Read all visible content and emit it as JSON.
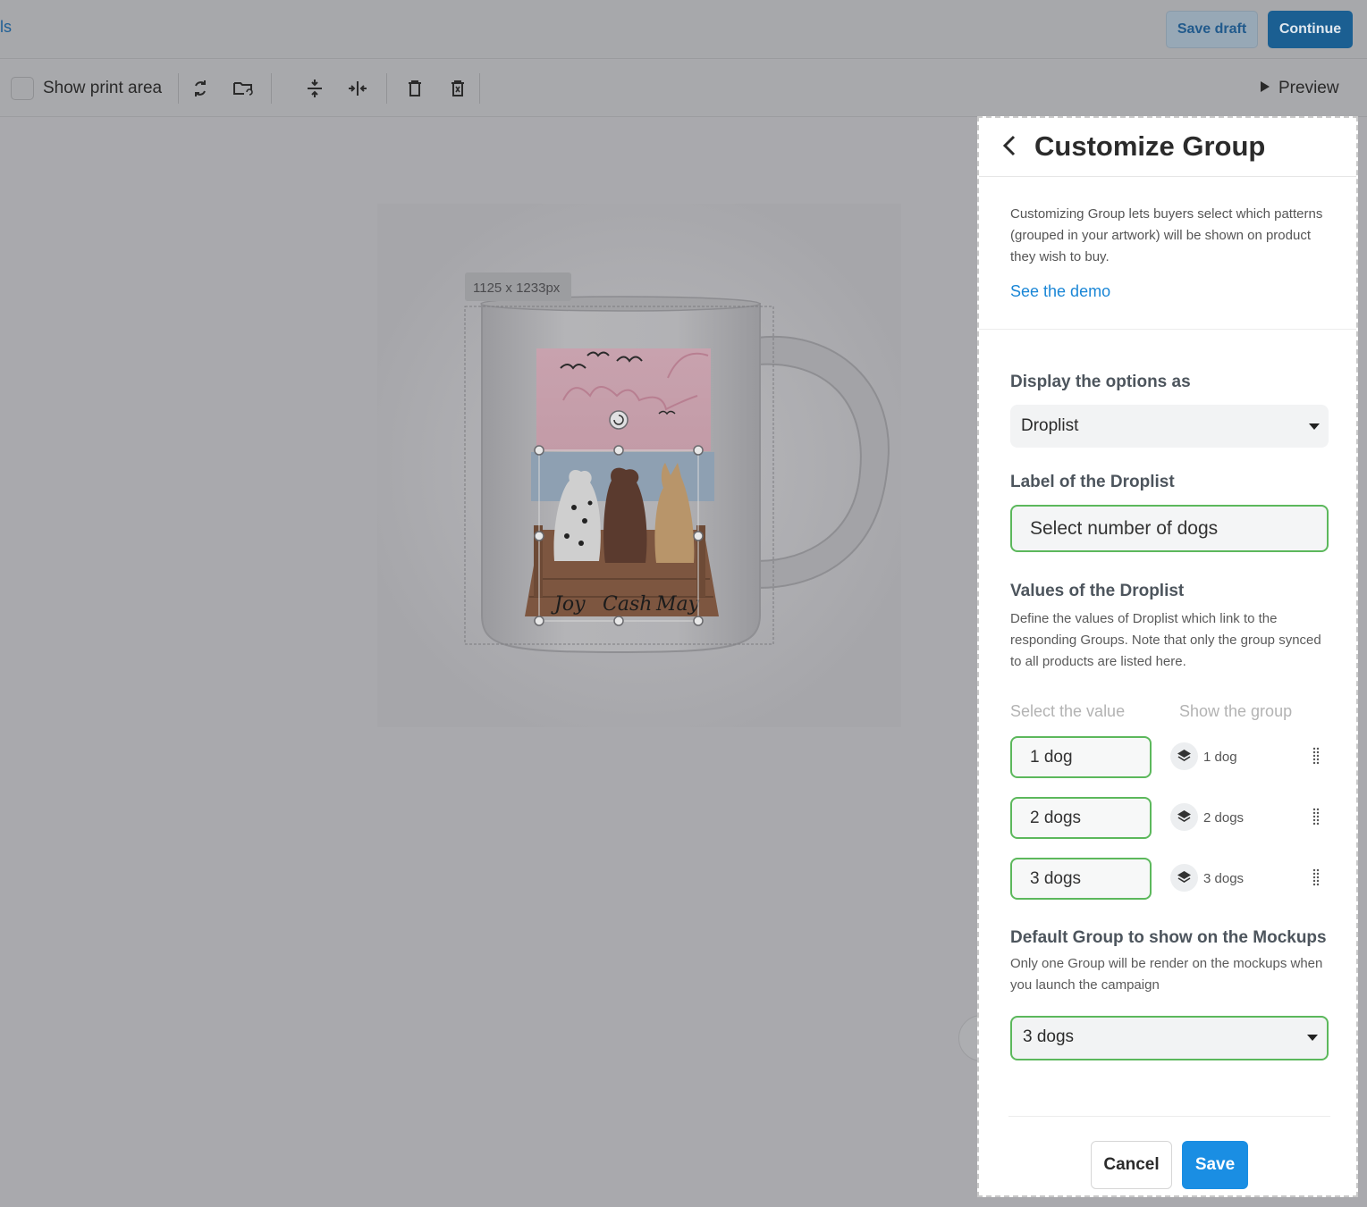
{
  "topbar": {
    "crumb": "ls",
    "save_draft": "Save draft",
    "continue": "Continue"
  },
  "toolbar": {
    "show_print_area": "Show print area",
    "preview": "Preview"
  },
  "canvas": {
    "size_label": "1125 x 1233px",
    "dog_names": [
      "Joy",
      "Cash",
      "May"
    ]
  },
  "panel": {
    "title": "Customize Group",
    "intro": "Customizing Group lets buyers select which patterns (grouped in your artwork) will be shown on product they wish to buy.",
    "demo_link": "See the demo",
    "display_title": "Display the options as",
    "display_value": "Droplist",
    "label_title": "Label of the Droplist",
    "label_value": "Select number of dogs",
    "values_title": "Values of the Droplist",
    "values_desc": "Define the values of Droplist which link to the responding Groups. Note that only the group synced to all products are listed here.",
    "col_value": "Select the value",
    "col_group": "Show the group",
    "rows": [
      {
        "value": "1 dog",
        "group": "1 dog"
      },
      {
        "value": "2 dogs",
        "group": "2 dogs"
      },
      {
        "value": "3 dogs",
        "group": "3 dogs"
      }
    ],
    "default_title": "Default Group to show on the Mockups",
    "default_desc": "Only one Group will be render on the mockups when you launch the campaign",
    "default_value": "3 dogs",
    "cancel": "Cancel",
    "save": "Save"
  },
  "colors": {
    "accent": "#1a8ee3",
    "success_border": "#5cb85c",
    "overlay": "#a9a9ad"
  }
}
